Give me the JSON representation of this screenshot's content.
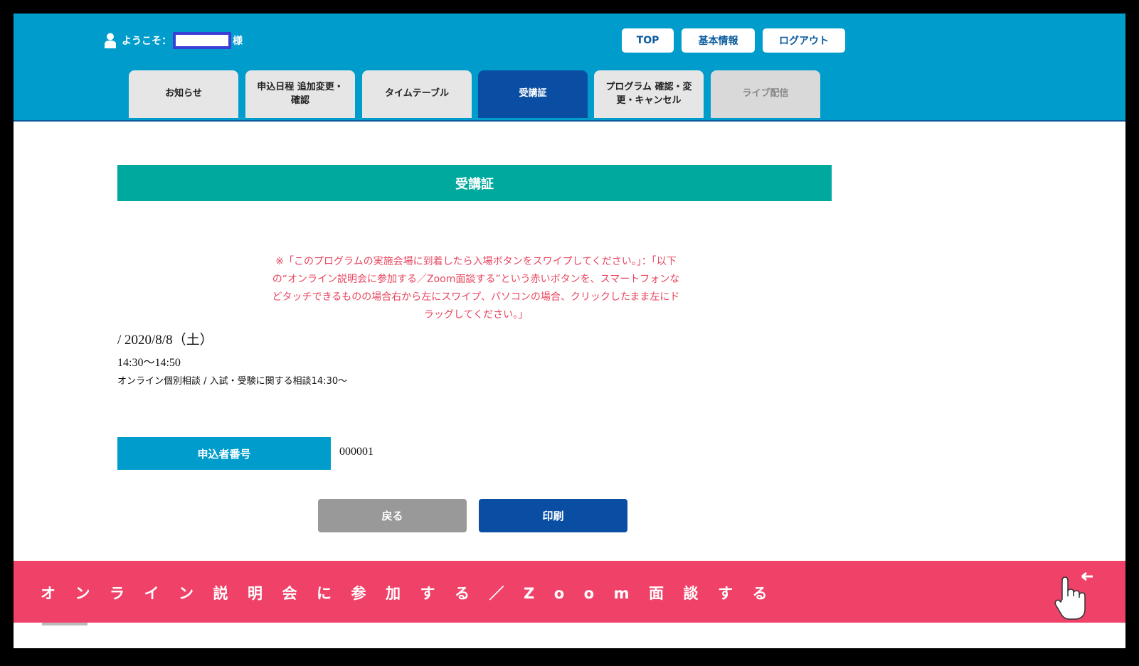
{
  "header": {
    "welcome_prefix": "ようこそ：",
    "welcome_suffix": "様",
    "buttons": {
      "top": "TOP",
      "basic_info": "基本情報",
      "logout": "ログアウト"
    }
  },
  "tabs": [
    {
      "label": "お知らせ",
      "state": "normal"
    },
    {
      "label": "申込日程 追加変更・確認",
      "state": "normal"
    },
    {
      "label": "タイムテーブル",
      "state": "normal"
    },
    {
      "label": "受講証",
      "state": "active"
    },
    {
      "label": "プログラム 確認・変更・キャンセル",
      "state": "normal"
    },
    {
      "label": "ライブ配信",
      "state": "disabled"
    }
  ],
  "main": {
    "title": "受講証",
    "notice": "※「このプログラムの実施会場に到着したら入場ボタンをスワイプしてください。」：「以下の“オンライン説明会に参加する／Zoom面談する”という赤いボタンを、スマートフォンなどタッチできるものの場合右から左にスワイプ、パソコンの場合、クリックしたまま左にドラッグしてください。」",
    "date": "/ 2020/8/8（土）",
    "time": "14:30〜14:50",
    "program": "オンライン個別相談 / 入試・受験に関する相談14:30〜",
    "applicant_label": "申込者番号",
    "applicant_number": "000001",
    "back_button": "戻る",
    "print_button": "印刷"
  },
  "swipe_bar": {
    "label": "オンライン説明会に参加する／Zoom面談する",
    "icon": "swipe-hand-icon"
  },
  "colors": {
    "header_blue": "#009dcc",
    "active_tab": "#0a4ea3",
    "title_green": "#00a99d",
    "notice_red": "#e8465f",
    "swipe_pink": "#f04268"
  }
}
